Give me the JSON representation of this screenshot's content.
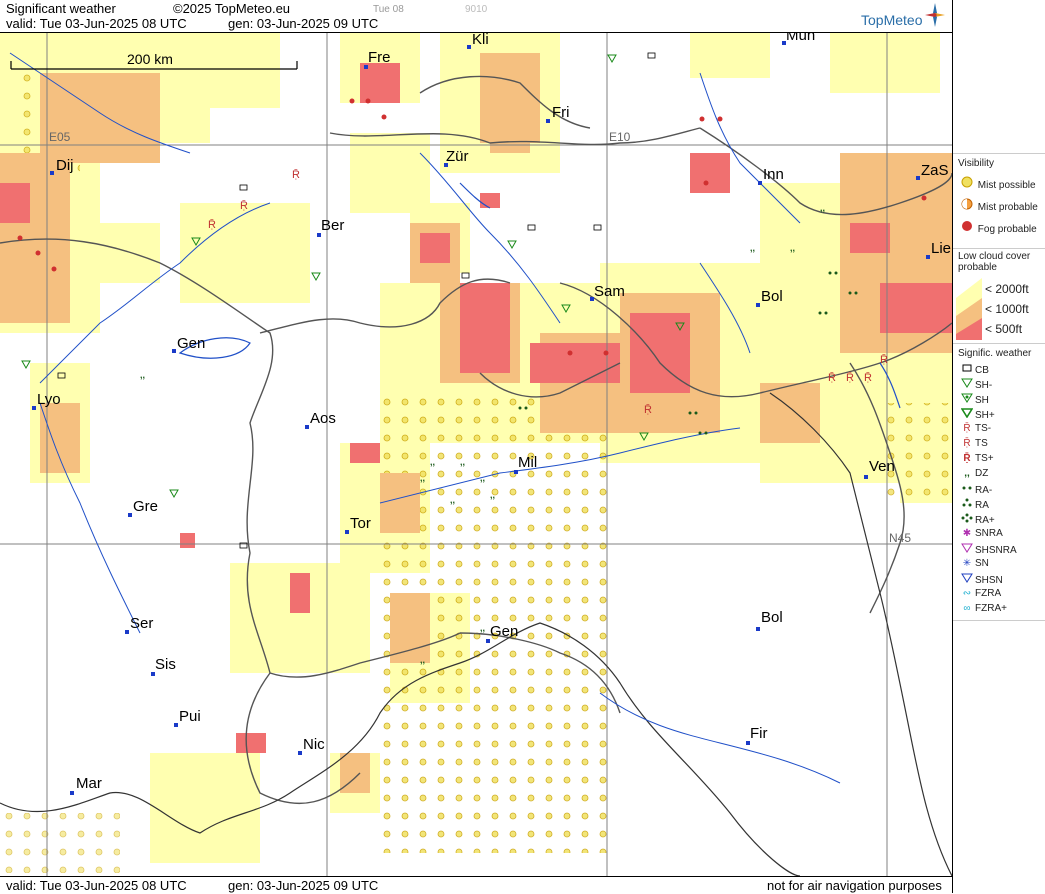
{
  "header": {
    "title": "Significant weather",
    "copyright": "©2025 TopMeteo.eu",
    "faint_day": "Tue 08",
    "faint_code": "9010",
    "valid": "valid:  Tue  03-Jun-2025  08 UTC",
    "gen": "gen:  03-Jun-2025 09 UTC",
    "logo": "TopMeteo"
  },
  "footer": {
    "valid": "valid:  Tue  03-Jun-2025  08 UTC",
    "gen": "gen:  03-Jun-2025 09 UTC",
    "disclaimer": "not for air navigation purposes"
  },
  "map": {
    "scale_label": "200 km",
    "grid_labels": {
      "lon1": "E05",
      "lon2": "E10",
      "lat1": "N45"
    },
    "cities": [
      "Dij",
      "Fre",
      "Kli",
      "Mün",
      "Fri",
      "Zür",
      "Inn",
      "ZaS",
      "Lie",
      "Ber",
      "Sam",
      "Bol",
      "Gen",
      "Lyo",
      "Aos",
      "Mil",
      "Ven",
      "Gre",
      "Tor",
      "Ser",
      "Sis",
      "Gen",
      "Bol",
      "Pui",
      "Nic",
      "Fir",
      "Mar"
    ],
    "colors": {
      "fog": "#f07070",
      "mist_probable": "#f5c080",
      "mist_possible": "#ffffb0",
      "border": "#555555",
      "water": "#2050c8",
      "grid": "#808080"
    }
  },
  "legend": {
    "visibility": {
      "title": "Visibility",
      "items": [
        {
          "icon": "mist-possible-icon",
          "label": "Mist possible"
        },
        {
          "icon": "mist-probable-icon",
          "label": "Mist probable"
        },
        {
          "icon": "fog-probable-icon",
          "label": "Fog probable"
        }
      ]
    },
    "cloud": {
      "title": "Low cloud cover probable",
      "items": [
        {
          "label": "< 2000ft",
          "color": "#ffffb0"
        },
        {
          "label": "< 1000ft",
          "color": "#f5c080"
        },
        {
          "label": "<   500ft",
          "color": "#f07070"
        }
      ]
    },
    "weather": {
      "title": "Signific. weather",
      "items": [
        {
          "icon": "cb-icon",
          "label": "CB"
        },
        {
          "icon": "shower-light-icon",
          "label": "SH-"
        },
        {
          "icon": "shower-icon",
          "label": "SH"
        },
        {
          "icon": "shower-heavy-icon",
          "label": "SH+"
        },
        {
          "icon": "thunderstorm-light-icon",
          "label": "TS-"
        },
        {
          "icon": "thunderstorm-icon",
          "label": "TS"
        },
        {
          "icon": "thunderstorm-heavy-icon",
          "label": "TS+"
        },
        {
          "icon": "drizzle-icon",
          "label": "DZ"
        },
        {
          "icon": "rain-light-icon",
          "label": "RA-"
        },
        {
          "icon": "rain-icon",
          "label": "RA"
        },
        {
          "icon": "rain-heavy-icon",
          "label": "RA+"
        },
        {
          "icon": "snow-rain-icon",
          "label": "SNRA"
        },
        {
          "icon": "snow-rain-shower-icon",
          "label": "SHSNRA"
        },
        {
          "icon": "snow-icon",
          "label": "SN"
        },
        {
          "icon": "snow-shower-icon",
          "label": "SHSN"
        },
        {
          "icon": "freezing-rain-icon",
          "label": "FZRA"
        },
        {
          "icon": "freezing-rain-heavy-icon",
          "label": "FZRA+"
        }
      ]
    }
  }
}
